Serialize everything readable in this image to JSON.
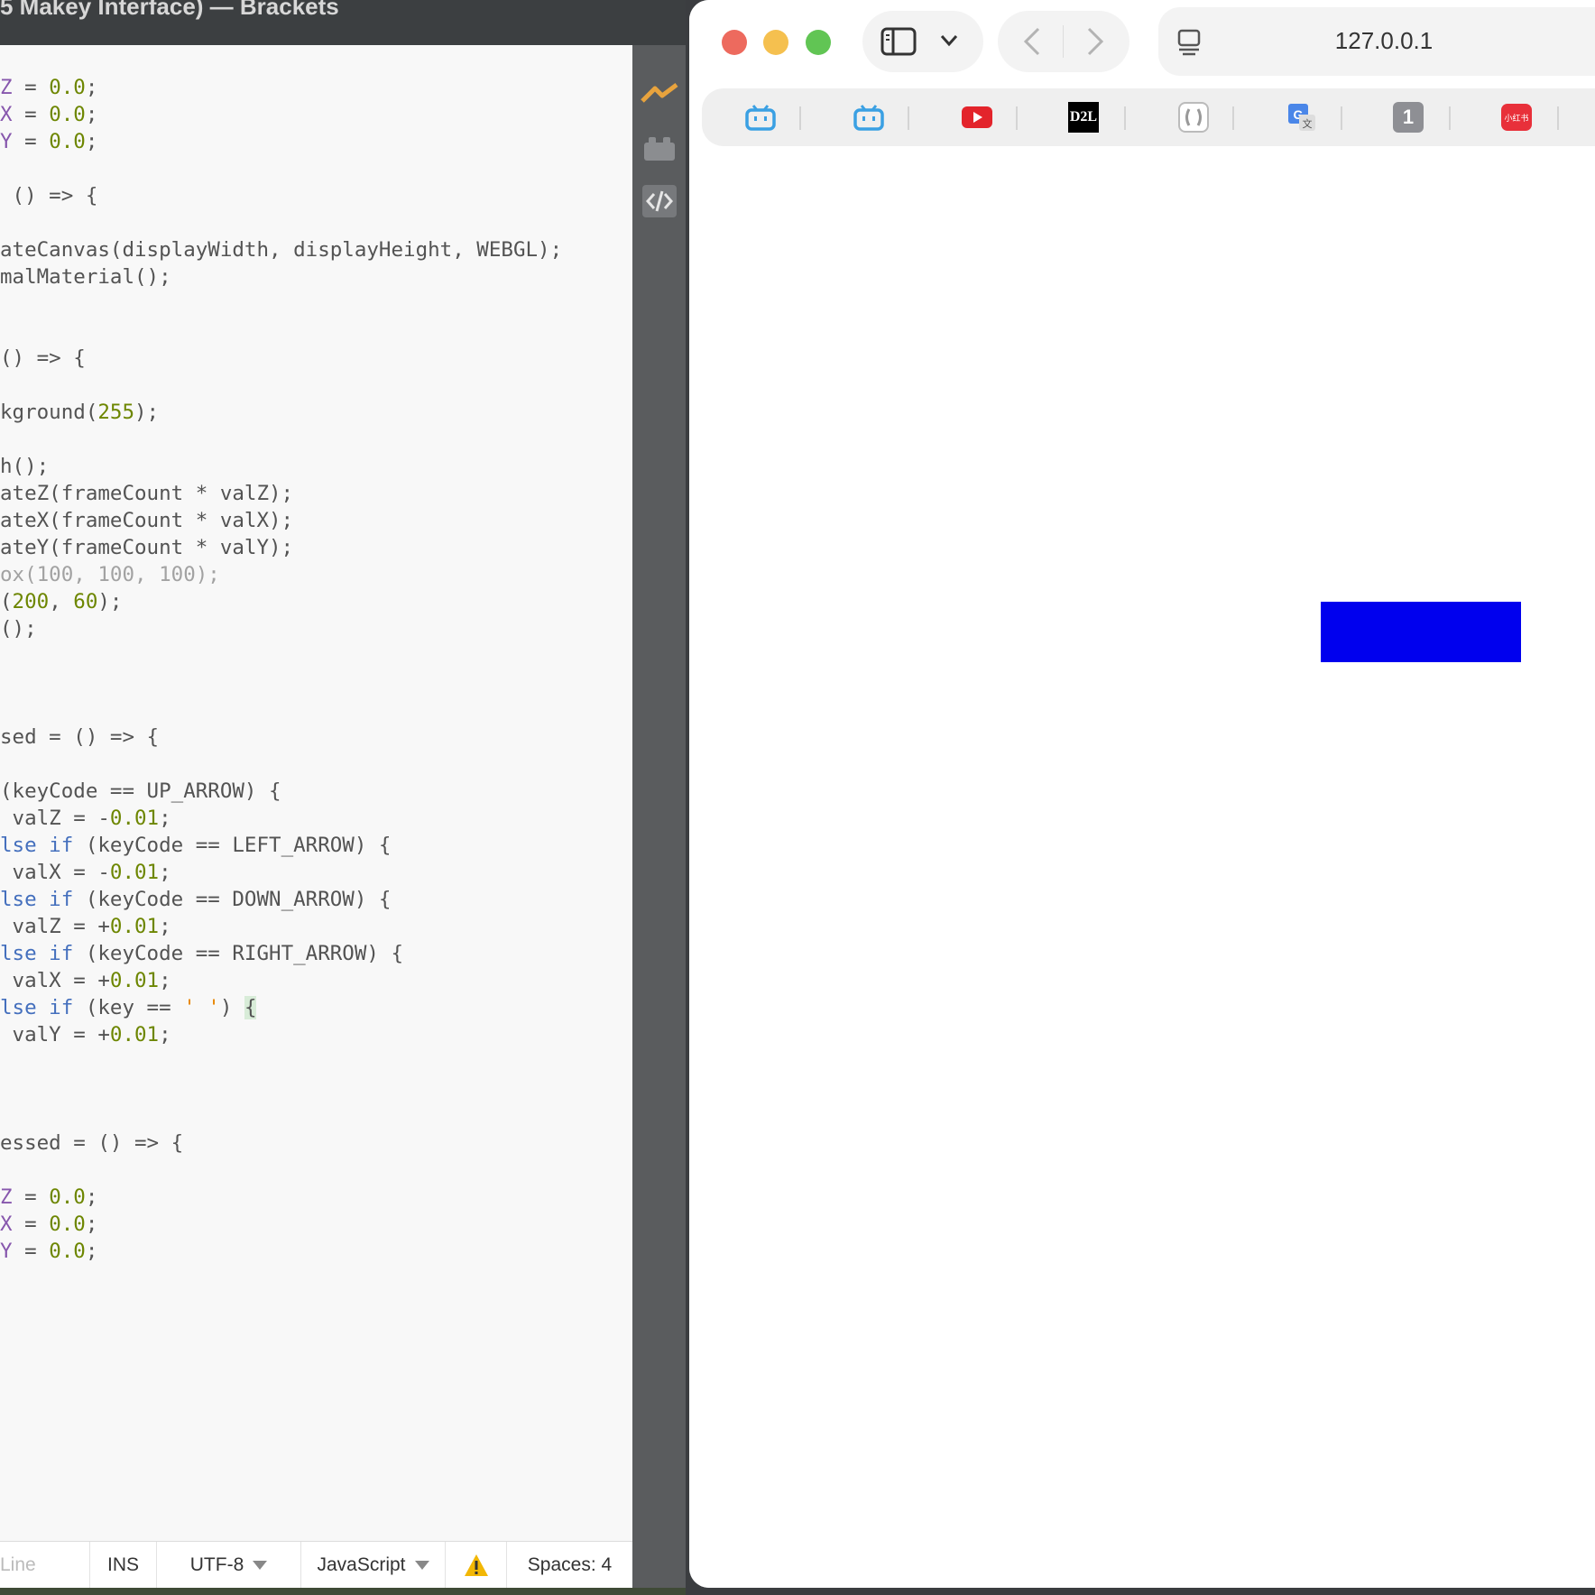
{
  "editor": {
    "title": "5 Makey Interface) — Brackets",
    "code_lines": [
      [
        {
          "t": "Z",
          "c": "var"
        },
        {
          "t": " = "
        },
        {
          "t": "0.0",
          "c": "num"
        },
        {
          "t": ";"
        }
      ],
      [
        {
          "t": "X",
          "c": "var"
        },
        {
          "t": " = "
        },
        {
          "t": "0.0",
          "c": "num"
        },
        {
          "t": ";"
        }
      ],
      [
        {
          "t": "Y",
          "c": "var"
        },
        {
          "t": " = "
        },
        {
          "t": "0.0",
          "c": "num"
        },
        {
          "t": ";"
        }
      ],
      [],
      [
        {
          "t": " () => {"
        }
      ],
      [],
      [
        {
          "t": "ateCanvas(displayWidth, displayHeight, WEBGL);"
        }
      ],
      [
        {
          "t": "malMaterial();"
        }
      ],
      [],
      [],
      [
        {
          "t": "() => {"
        }
      ],
      [],
      [
        {
          "t": "kground("
        },
        {
          "t": "255",
          "c": "num"
        },
        {
          "t": ");"
        }
      ],
      [],
      [
        {
          "t": "h();"
        }
      ],
      [
        {
          "t": "ateZ(frameCount * valZ);"
        }
      ],
      [
        {
          "t": "ateX(frameCount * valX);"
        }
      ],
      [
        {
          "t": "ateY(frameCount * valY);"
        }
      ],
      [
        {
          "t": "ox(100, 100, 100);",
          "c": "cmt"
        }
      ],
      [
        {
          "t": "("
        },
        {
          "t": "200",
          "c": "num"
        },
        {
          "t": ", "
        },
        {
          "t": "60",
          "c": "num"
        },
        {
          "t": ");"
        }
      ],
      [
        {
          "t": "();"
        }
      ],
      [],
      [],
      [],
      [
        {
          "t": "sed = () => {"
        }
      ],
      [],
      [
        {
          "t": "(keyCode == UP_ARROW) {"
        }
      ],
      [
        {
          "t": " valZ = -"
        },
        {
          "t": "0.01",
          "c": "num"
        },
        {
          "t": ";"
        }
      ],
      [
        {
          "t": "lse if",
          "c": "kw"
        },
        {
          "t": " (keyCode == LEFT_ARROW) {"
        }
      ],
      [
        {
          "t": " valX = -"
        },
        {
          "t": "0.01",
          "c": "num"
        },
        {
          "t": ";"
        }
      ],
      [
        {
          "t": "lse if",
          "c": "kw"
        },
        {
          "t": " (keyCode == DOWN_ARROW) {"
        }
      ],
      [
        {
          "t": " valZ = +"
        },
        {
          "t": "0.01",
          "c": "num"
        },
        {
          "t": ";"
        }
      ],
      [
        {
          "t": "lse if",
          "c": "kw"
        },
        {
          "t": " (keyCode == RIGHT_ARROW) {"
        }
      ],
      [
        {
          "t": " valX = +"
        },
        {
          "t": "0.01",
          "c": "num"
        },
        {
          "t": ";"
        }
      ],
      [
        {
          "t": "lse if",
          "c": "kw"
        },
        {
          "t": " (key == "
        },
        {
          "t": "' '",
          "c": "str"
        },
        {
          "t": ") "
        },
        {
          "t": "{",
          "c": "br"
        }
      ],
      [
        {
          "t": " valY = +"
        },
        {
          "t": "0.01",
          "c": "num"
        },
        {
          "t": ";"
        }
      ],
      [],
      [],
      [],
      [
        {
          "t": "essed = () => {"
        }
      ],
      [],
      [
        {
          "t": "Z",
          "c": "var"
        },
        {
          "t": " = "
        },
        {
          "t": "0.0",
          "c": "num"
        },
        {
          "t": ";"
        }
      ],
      [
        {
          "t": "X",
          "c": "var"
        },
        {
          "t": " = "
        },
        {
          "t": "0.0",
          "c": "num"
        },
        {
          "t": ";"
        }
      ],
      [
        {
          "t": "Y",
          "c": "var"
        },
        {
          "t": " = "
        },
        {
          "t": "0.0",
          "c": "num"
        },
        {
          "t": ";"
        }
      ]
    ],
    "status": {
      "line_placeholder": "Line",
      "mode": "INS",
      "encoding": "UTF-8",
      "language": "JavaScript",
      "spaces": "Spaces: 4"
    },
    "side_icons": [
      "live-preview-icon",
      "extension-manager-icon",
      "code-icon"
    ]
  },
  "browser": {
    "url": "127.0.0.1",
    "traffic_colors": [
      "#ed6a5e",
      "#f5c04f",
      "#61c554"
    ],
    "favorites": [
      {
        "name": "bilibili-icon",
        "label": ""
      },
      {
        "name": "bilibili-icon",
        "label": ""
      },
      {
        "name": "youtube-icon",
        "label": ""
      },
      {
        "name": "d2l-icon",
        "label": "D2L"
      },
      {
        "name": "bracket-app-icon",
        "label": ""
      },
      {
        "name": "google-translate-icon",
        "label": ""
      },
      {
        "name": "onepassword-icon",
        "label": "1"
      },
      {
        "name": "xiaohongshu-icon",
        "label": "小红书"
      }
    ],
    "canvas_rect_color": "#0000ee"
  }
}
